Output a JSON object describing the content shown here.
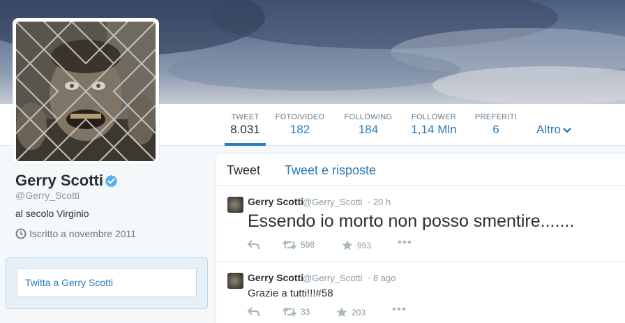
{
  "profile": {
    "name": "Gerry Scotti",
    "handle": "@Gerry_Scotti",
    "bio": "al secolo Virginio",
    "joined": "Iscritto a novembre 2011"
  },
  "stats": [
    {
      "label": "TWEET",
      "value": "8.031"
    },
    {
      "label": "FOTO/VIDEO",
      "value": "182"
    },
    {
      "label": "FOLLOWING",
      "value": "184"
    },
    {
      "label": "FOLLOWER",
      "value": "1,14 Mln"
    },
    {
      "label": "PREFERITI",
      "value": "6"
    }
  ],
  "more_label": "Altro",
  "tweet_to": {
    "placeholder": "Twitta a Gerry Scotti"
  },
  "tabs": {
    "tweets": "Tweet",
    "replies": "Tweet e risposte"
  },
  "tweets": [
    {
      "name": "Gerry Scotti",
      "handle": "@Gerry_Scotti",
      "time": "· 20 h",
      "text": "Essendo io morto non posso smentire.......",
      "retweets": "598",
      "favorites": "993"
    },
    {
      "name": "Gerry Scotti",
      "handle": "@Gerry_Scotti",
      "time": "· 8 ago",
      "text": "Grazie a tutti!!!#58",
      "retweets": "33",
      "favorites": "203"
    }
  ],
  "colors": {
    "link": "#2b7bb9",
    "verified": "#55acee",
    "muted": "#8899a6"
  }
}
